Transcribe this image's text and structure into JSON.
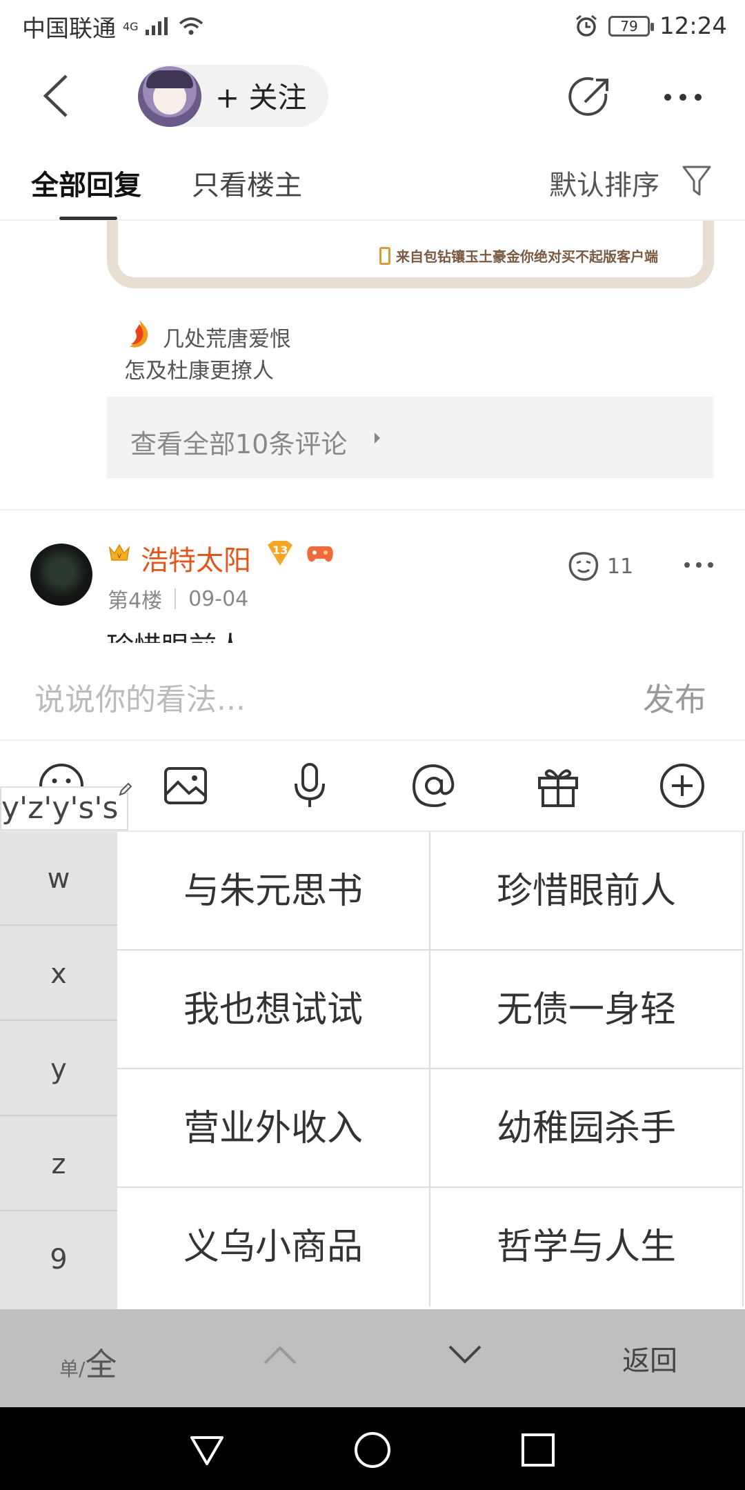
{
  "status_bar": {
    "carrier": "中国联通",
    "network": "4G",
    "battery": "79",
    "time": "12:24"
  },
  "nav": {
    "follow_label": "+ 关注"
  },
  "tabs": {
    "all_replies": "全部回复",
    "owner_only": "只看楼主",
    "sort": "默认排序"
  },
  "post_tail": {
    "client_text": "来自包钻镶玉土豪金你绝对买不起版客户端",
    "signature_line1": "几处荒唐爱恨",
    "signature_line2": "怎及杜康更撩人",
    "view_all": "查看全部10条评论"
  },
  "comment": {
    "user_name": "浩特太阳",
    "level": "13",
    "floor": "第4楼",
    "date": "09-04",
    "likes": "11",
    "text_peek": "珍惜眼前人"
  },
  "reply": {
    "placeholder": "说说你的看法...",
    "publish": "发布"
  },
  "ime": {
    "composition": "y'z'y's's",
    "letters": [
      "w",
      "x",
      "y",
      "z",
      "9"
    ],
    "candidates": [
      "与朱元思书",
      "珍惜眼前人",
      "我也想试试",
      "无债一身轻",
      "营业外收入",
      "幼稚园杀手",
      "义乌小商品",
      "哲学与人生"
    ],
    "half_label": "单/",
    "full_label": "全",
    "return_label": "返回"
  },
  "colors": {
    "username": "#e0561e",
    "card_border": "#e8ded1"
  }
}
